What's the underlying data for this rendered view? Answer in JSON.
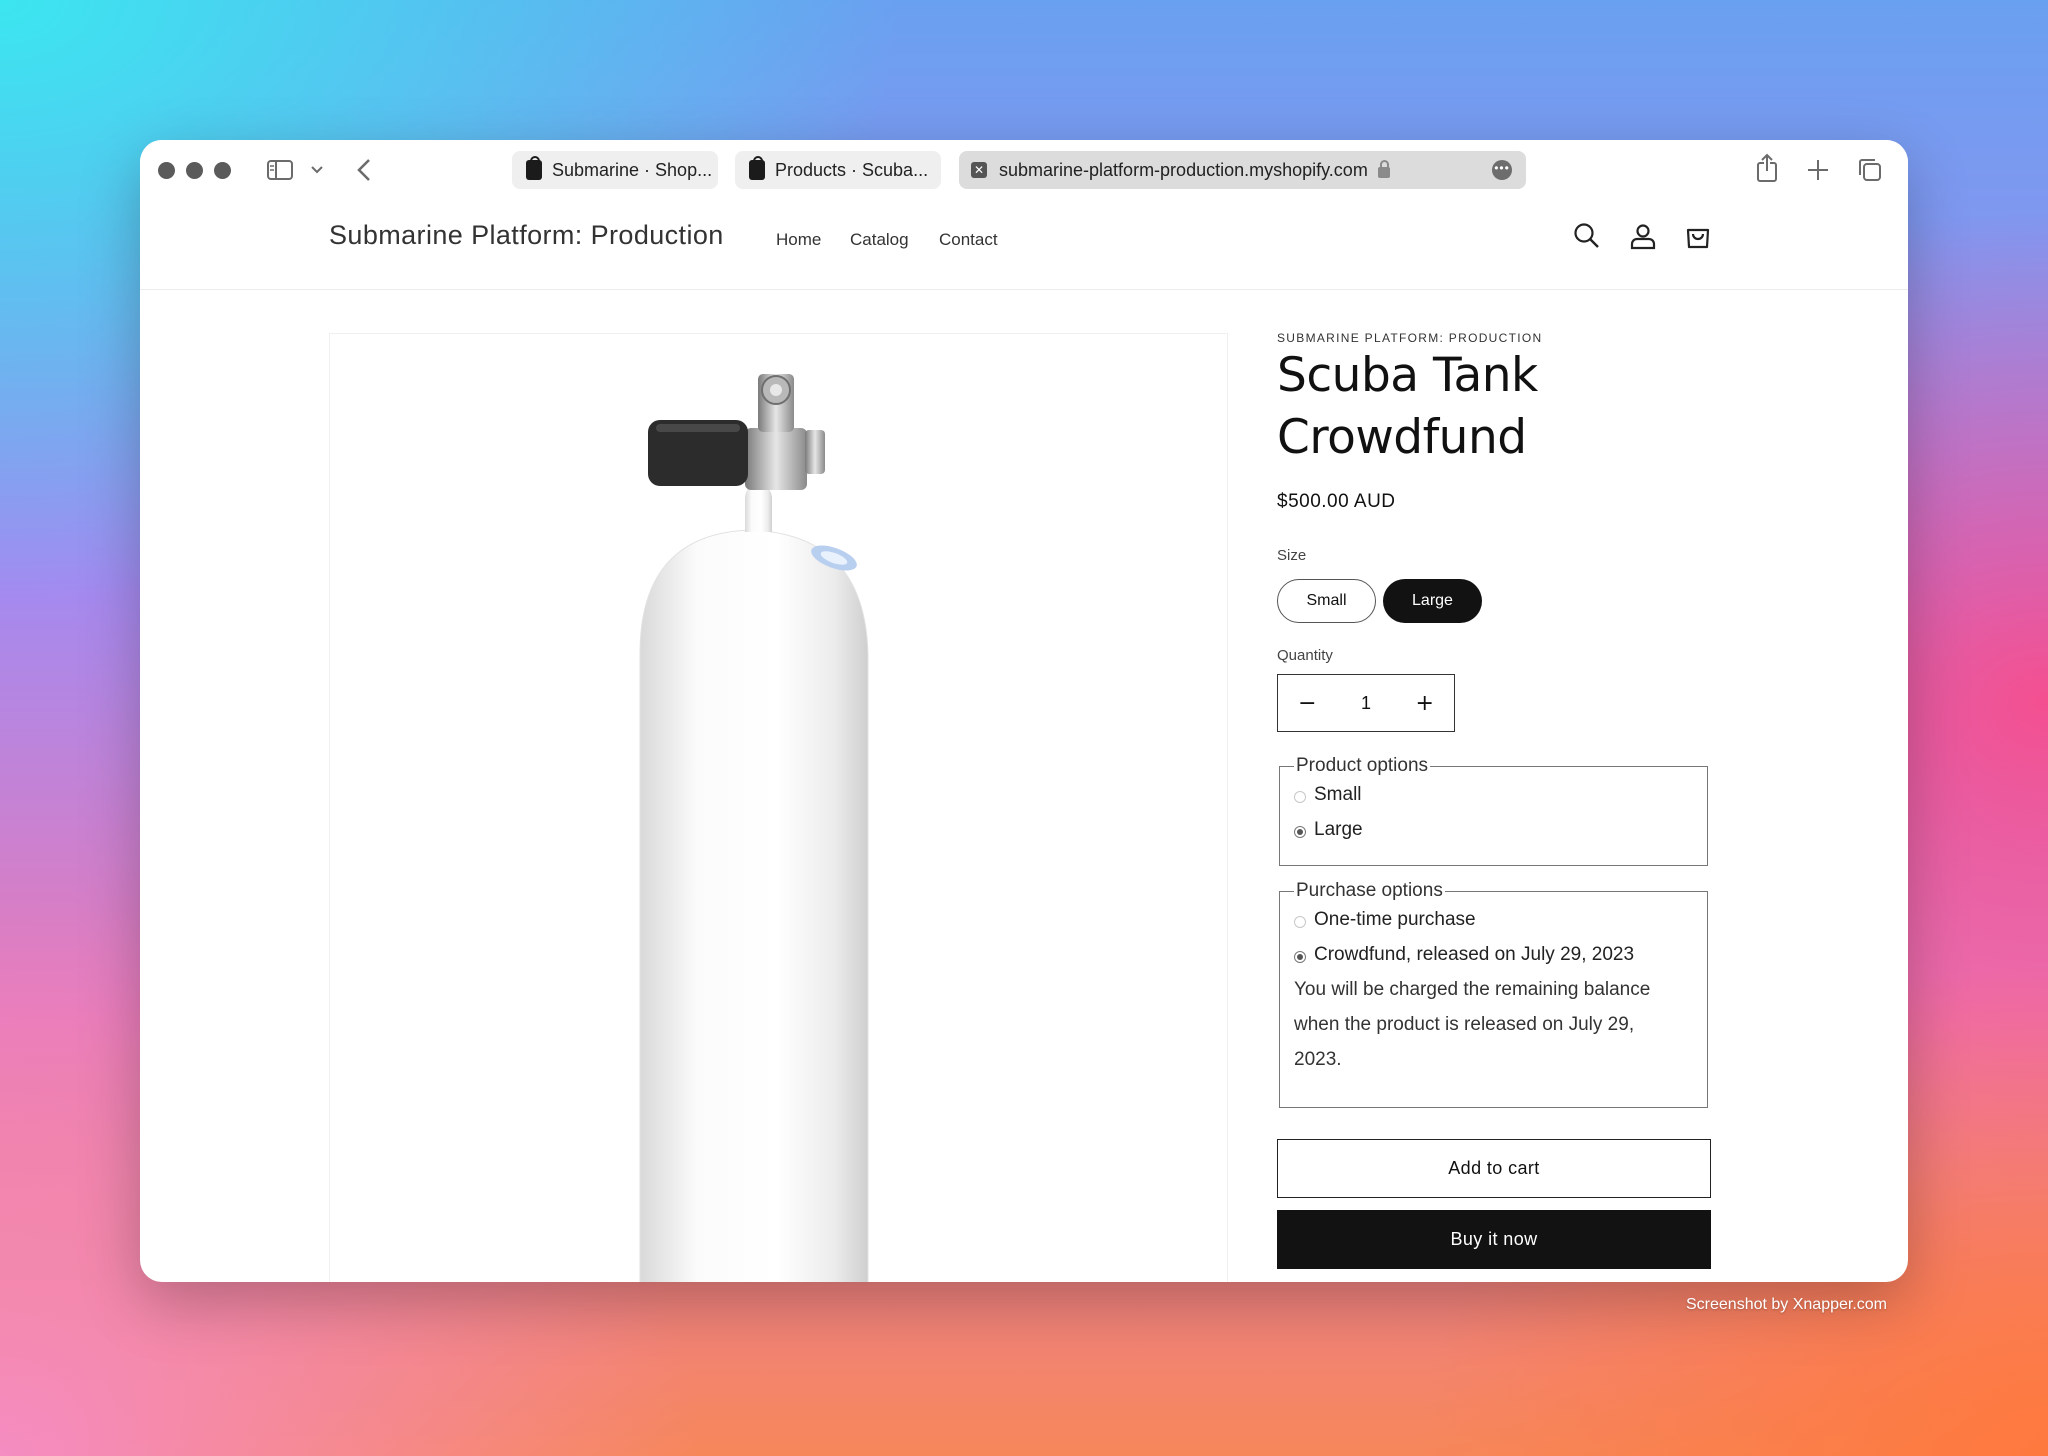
{
  "browser": {
    "tabs": [
      {
        "label": "Submarine · Shop..."
      },
      {
        "label": "Products · Scuba..."
      }
    ],
    "address": "submarine-platform-production.myshopify.com"
  },
  "store": {
    "name": "Submarine Platform: Production",
    "nav": [
      "Home",
      "Catalog",
      "Contact"
    ]
  },
  "product": {
    "vendor": "SUBMARINE PLATFORM: PRODUCTION",
    "title_line1": "Scuba Tank",
    "title_line2": "Crowdfund",
    "price": "$500.00 AUD",
    "size_label": "Size",
    "sizes": [
      "Small",
      "Large"
    ],
    "selected_size": "Large",
    "quantity_label": "Quantity",
    "quantity": "1",
    "minus": "−",
    "plus": "+"
  },
  "product_options": {
    "legend": "Product options",
    "options": [
      "Small",
      "Large"
    ],
    "selected": "Large"
  },
  "purchase_options": {
    "legend": "Purchase options",
    "options": [
      "One-time purchase",
      "Crowdfund, released on July 29, 2023"
    ],
    "selected": "Crowdfund, released on July 29, 2023",
    "note_line1": "You will be charged the remaining balance",
    "note_line2": "when the product is released on July 29,",
    "note_line3": "2023."
  },
  "actions": {
    "add_to_cart": "Add to cart",
    "buy_now": "Buy it now"
  },
  "credit": "Screenshot by Xnapper.com",
  "colors": {
    "button_dark": "#121212",
    "text": "#111111"
  }
}
